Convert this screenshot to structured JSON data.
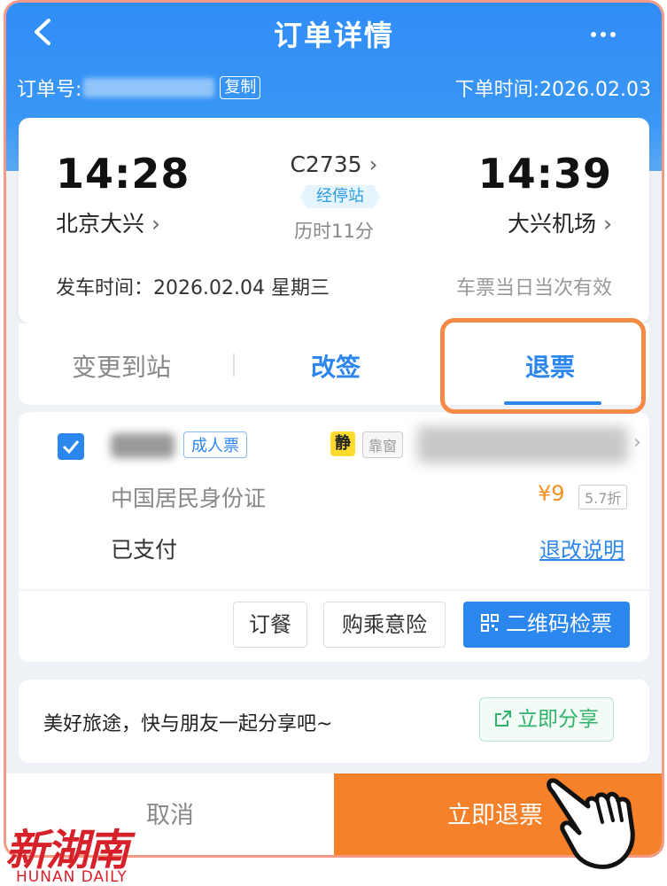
{
  "nav": {
    "title": "订单详情"
  },
  "order": {
    "number_label": "订单号:",
    "copy_label": "复制",
    "order_time": "下单时间:2026.02.03"
  },
  "trip": {
    "departure_time": "14:28",
    "arrival_time": "14:39",
    "departure_station": "北京大兴",
    "arrival_station": "大兴机场",
    "train_number": "C2735",
    "via_label": "经停站",
    "duration": "历时11分",
    "departure_date": "发车时间：2026.02.04 星期三",
    "validity": "车票当日当次有效"
  },
  "actions": {
    "change_station": "变更到站",
    "rebook": "改签",
    "refund": "退票"
  },
  "passenger": {
    "ticket_type": "成人票",
    "quiet_tag": "静",
    "seat_tag": "靠窗",
    "id_type": "中国居民身份证",
    "price": "¥9",
    "discount": "5.7折",
    "pay_status": "已支付",
    "refund_info": "退改说明"
  },
  "services": {
    "meal": "订餐",
    "insurance": "购乘意险",
    "qr_check": "二维码检票"
  },
  "share": {
    "text": "美好旅途，快与朋友一起分享吧~",
    "button": "立即分享"
  },
  "bottom": {
    "cancel": "取消",
    "refund_now": "立即退票"
  },
  "watermark": {
    "logo": "新湖南",
    "sub": "HUNAN DAILY"
  },
  "colors": {
    "header_blue": "#3a97f5",
    "accent_blue": "#2b86ee",
    "refund_orange": "#f5812b",
    "highlight_orange": "#f48a45",
    "price_orange": "#f7901e",
    "share_green": "#2fb36a"
  }
}
